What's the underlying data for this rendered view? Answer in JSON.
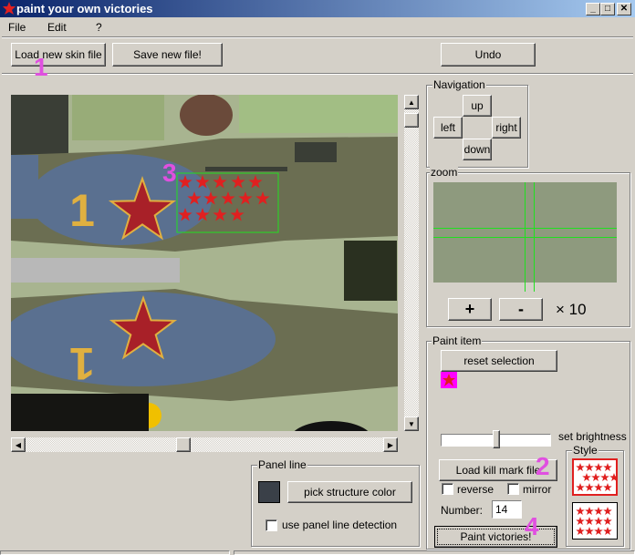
{
  "window": {
    "title": "paint your own victories",
    "min": "_",
    "max": "□",
    "close": "✕"
  },
  "menu": [
    "File",
    "Edit",
    "?"
  ],
  "toolbar": {
    "load_skin": "Load new skin file",
    "save": "Save new file!",
    "undo": "Undo"
  },
  "navigation": {
    "title": "Navigation",
    "up": "up",
    "left": "left",
    "right": "right",
    "down": "down"
  },
  "zoom": {
    "title": "zoom",
    "plus": "+",
    "minus": "-",
    "factor": "× 10"
  },
  "paint_item": {
    "title": "Paint item",
    "reset": "reset selection",
    "brightness_label": "set brightness",
    "brightness_value": 0.5,
    "load_kill_mark": "Load kill mark file",
    "reverse_label": "reverse",
    "reverse": false,
    "mirror_label": "mirror",
    "mirror": false,
    "number_label": "Number:",
    "number": "14",
    "paint": "Paint victories!",
    "style_title": "Style",
    "selected_style": 0
  },
  "panel_line": {
    "title": "Panel line",
    "pick": "pick structure color",
    "color": "#3a4048",
    "detection_label": "use panel line detection",
    "detection": false
  },
  "canvas": {
    "number_marking": "1"
  },
  "annotations": [
    "1",
    "2",
    "3",
    "4"
  ],
  "colors": {
    "star": "#e02020",
    "marker": "#ff00ff",
    "selection": "#20e020",
    "annotation": "#e050e0"
  }
}
